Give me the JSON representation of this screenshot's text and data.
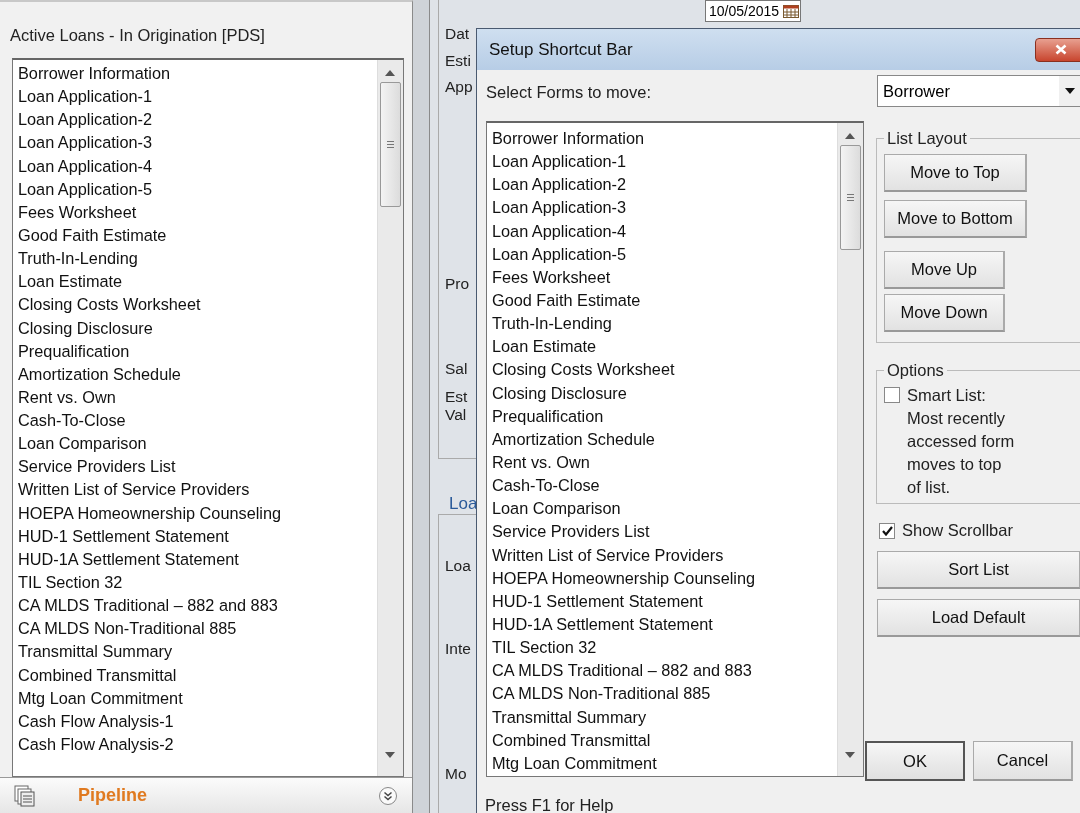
{
  "left_panel": {
    "title": "Active Loans - In Origination [PDS]",
    "forms": [
      "Borrower Information",
      "Loan Application-1",
      "Loan Application-2",
      "Loan Application-3",
      "Loan Application-4",
      "Loan Application-5",
      "Fees Worksheet",
      "Good Faith Estimate",
      "Truth-In-Lending",
      "Loan Estimate",
      "Closing Costs Worksheet",
      "Closing Disclosure",
      "Prequalification",
      "Amortization Schedule",
      "Rent vs. Own",
      "Cash-To-Close",
      "Loan Comparison",
      "Service Providers List",
      "Written List of Service Providers",
      "HOEPA Homeownership Counseling",
      "HUD-1 Settlement Statement",
      "HUD-1A Settlement Statement",
      "TIL Section 32",
      "CA MLDS Traditional – 882 and 883",
      "CA MLDS Non-Traditional 885",
      "Transmittal Summary",
      "Combined Transmittal",
      "Mtg Loan Commitment",
      "Cash Flow Analysis-1",
      "Cash Flow Analysis-2"
    ],
    "nav": {
      "label": "Pipeline"
    }
  },
  "background_form": {
    "date_value": "10/05/2015",
    "labels": [
      "Dat",
      "Esti",
      "App",
      "Pro",
      "Sal",
      "Est",
      "Val",
      "Loa",
      "Inte",
      "Mo"
    ],
    "group_legend": "Loa"
  },
  "dialog": {
    "title": "Setup Shortcut Bar",
    "select_label": "Select Forms to move:",
    "form_group": "Borrower",
    "forms": [
      "Borrower Information",
      "Loan Application-1",
      "Loan Application-2",
      "Loan Application-3",
      "Loan Application-4",
      "Loan Application-5",
      "Fees Worksheet",
      "Good Faith Estimate",
      "Truth-In-Lending",
      "Loan Estimate",
      "Closing Costs Worksheet",
      "Closing Disclosure",
      "Prequalification",
      "Amortization Schedule",
      "Rent vs. Own",
      "Cash-To-Close",
      "Loan Comparison",
      "Service Providers List",
      "Written List of Service Providers",
      "HOEPA Homeownership Counseling",
      "HUD-1 Settlement Statement",
      "HUD-1A Settlement Statement",
      "TIL Section 32",
      "CA MLDS Traditional – 882 and 883",
      "CA MLDS Non-Traditional 885",
      "Transmittal Summary",
      "Combined Transmittal",
      "Mtg Loan Commitment"
    ],
    "list_layout": {
      "legend": "List Layout",
      "buttons": [
        "Move to Top",
        "Move to Bottom",
        "Move Up",
        "Move Down"
      ]
    },
    "options": {
      "legend": "Options",
      "smart_list": {
        "label": "Smart List: Most recently accessed form moves to top of list.",
        "checked": false
      }
    },
    "show_scrollbar": {
      "label": "Show Scrollbar",
      "checked": true
    },
    "buttons": [
      "Sort List",
      "Load Default"
    ],
    "ok": "OK",
    "cancel": "Cancel",
    "status": "Press F1 for Help"
  }
}
